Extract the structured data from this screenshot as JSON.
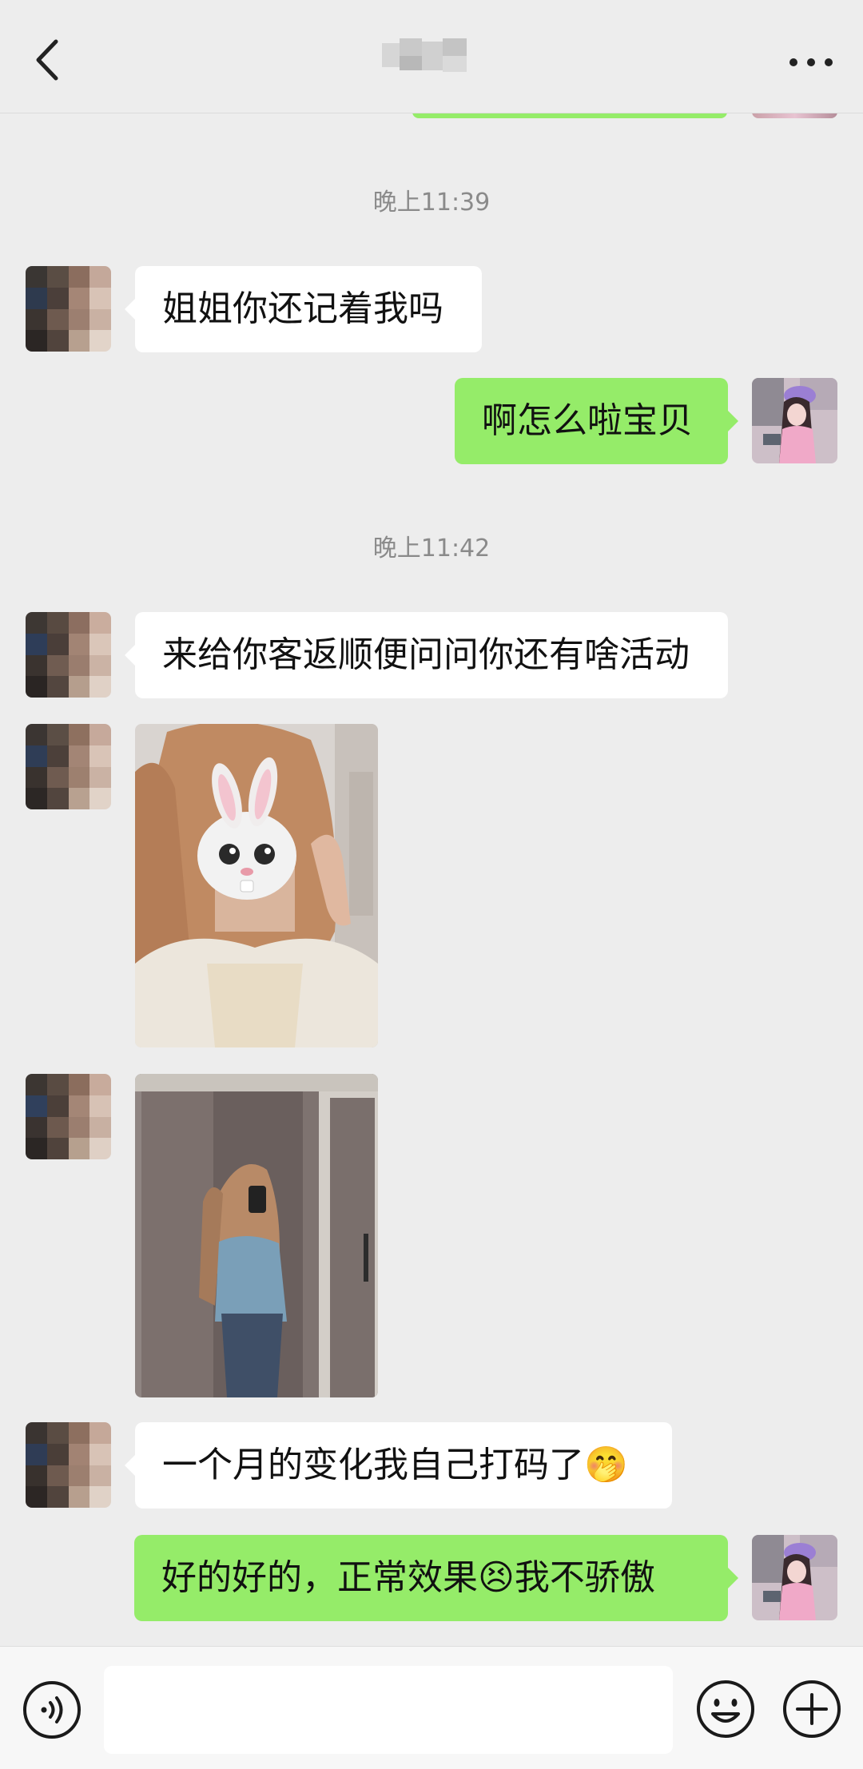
{
  "chat": {
    "title": "",
    "messages": [
      {
        "type": "timestamp",
        "text": "晚上11:39"
      },
      {
        "type": "text",
        "direction": "in",
        "text": "姐姐你还记着我吗"
      },
      {
        "type": "text",
        "direction": "out",
        "text": "啊怎么啦宝贝"
      },
      {
        "type": "timestamp",
        "text": "晚上11:42"
      },
      {
        "type": "text",
        "direction": "in",
        "text": "来给你客返顺便问问你还有啥活动"
      },
      {
        "type": "image",
        "direction": "in",
        "description": "photo-1"
      },
      {
        "type": "image",
        "direction": "in",
        "description": "photo-2"
      },
      {
        "type": "text",
        "direction": "in",
        "text": "一个月的变化我自己打码了🤭"
      },
      {
        "type": "text",
        "direction": "out",
        "text": "好的好的，正常效果😣我不骄傲"
      }
    ]
  },
  "input": {
    "value": "",
    "placeholder": ""
  },
  "icons": {
    "back": "chevron-left-icon",
    "more": "more-dots-icon",
    "voice": "voice-icon",
    "emoji": "emoji-icon",
    "plus": "plus-icon"
  },
  "colors": {
    "background": "#ededed",
    "outgoing_bubble": "#95ec69",
    "incoming_bubble": "#ffffff",
    "timestamp_text": "#8a8a8a"
  }
}
